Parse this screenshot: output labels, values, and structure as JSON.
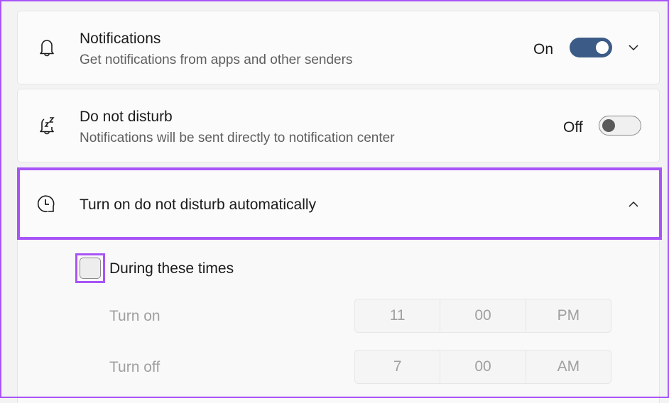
{
  "notifications": {
    "title": "Notifications",
    "subtitle": "Get notifications from apps and other senders",
    "state_label": "On",
    "toggle_on": true,
    "icon": "bell-icon",
    "expand_icon": "chevron-down-icon"
  },
  "do_not_disturb": {
    "title": "Do not disturb",
    "subtitle": "Notifications will be sent directly to notification center",
    "state_label": "Off",
    "toggle_on": false,
    "icon": "bell-snooze-icon"
  },
  "auto_dnd": {
    "title": "Turn on do not disturb automatically",
    "icon": "clock-arrow-icon",
    "collapse_icon": "chevron-up-icon",
    "during_times": {
      "label": "During these times",
      "checked": false
    },
    "turn_on": {
      "label": "Turn on",
      "hour": "11",
      "minute": "00",
      "period": "PM"
    },
    "turn_off": {
      "label": "Turn off",
      "hour": "7",
      "minute": "00",
      "period": "AM"
    }
  },
  "colors": {
    "accent": "#3c5c87",
    "highlight": "#a855f7"
  }
}
